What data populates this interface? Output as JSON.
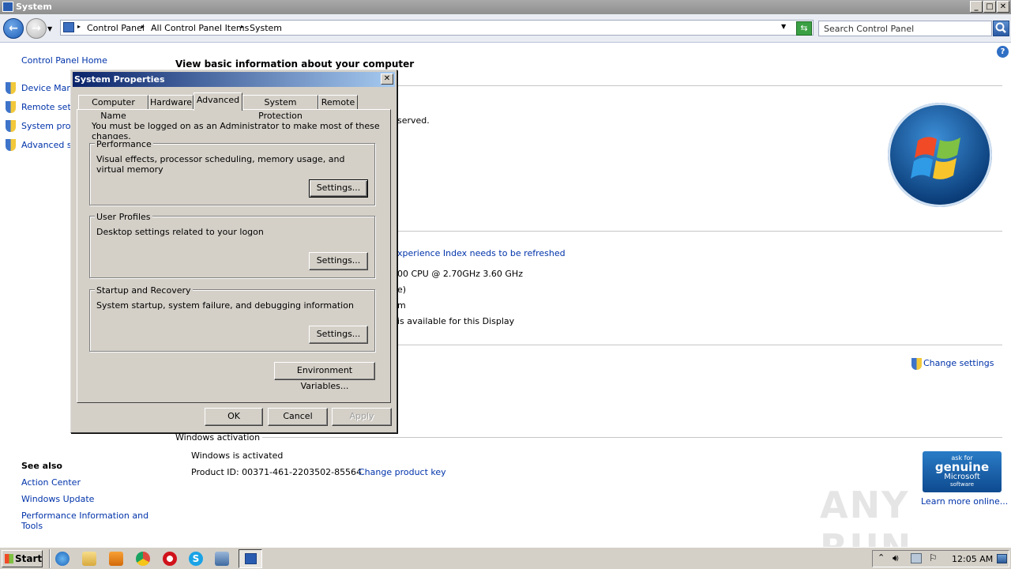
{
  "window": {
    "title": "System",
    "min": "_",
    "max": "□",
    "close": "✕"
  },
  "address": {
    "crumbs": [
      "Control Panel",
      "All Control Panel Items",
      "System"
    ],
    "search_placeholder": "Search Control Panel"
  },
  "sidebar": {
    "home": "Control Panel Home",
    "items": [
      "Device Mana",
      "Remote setti",
      "System prote",
      "Advanced sy"
    ],
    "see_also_title": "See also",
    "see_also": [
      "Action Center",
      "Windows Update",
      "Performance Information and",
      "Tools"
    ]
  },
  "main": {
    "heading": "View basic information about your computer",
    "reserved": "served.",
    "experience": "xperience Index needs to be refreshed",
    "cpu": "00 CPU @ 2.70GHz   3.60 GHz",
    "ram": "e)",
    "systype": "m",
    "pen": "is available for this Display",
    "change_settings": "Change settings",
    "activation_label": "Windows activation",
    "activated": "Windows is activated",
    "product_id": "Product ID:  00371-461-2203502-85564",
    "change_key": "Change product key",
    "learn_more": "Learn more online...",
    "genuine": [
      "ask for",
      "genuine",
      "Microsoft",
      "software"
    ]
  },
  "dialog": {
    "title": "System Properties",
    "tabs": [
      "Computer Name",
      "Hardware",
      "Advanced",
      "System Protection",
      "Remote"
    ],
    "note": "You must be logged on as an Administrator to make most of these changes.",
    "performance": {
      "label": "Performance",
      "desc": "Visual effects, processor scheduling, memory usage, and virtual memory",
      "button": "Settings..."
    },
    "profiles": {
      "label": "User Profiles",
      "desc": "Desktop settings related to your logon",
      "button": "Settings..."
    },
    "startup": {
      "label": "Startup and Recovery",
      "desc": "System startup, system failure, and debugging information",
      "button": "Settings..."
    },
    "env_button": "Environment Variables...",
    "ok": "OK",
    "cancel": "Cancel",
    "apply": "Apply"
  },
  "taskbar": {
    "start": "Start",
    "clock": "12:05 AM"
  },
  "watermark": "ANY RUN"
}
